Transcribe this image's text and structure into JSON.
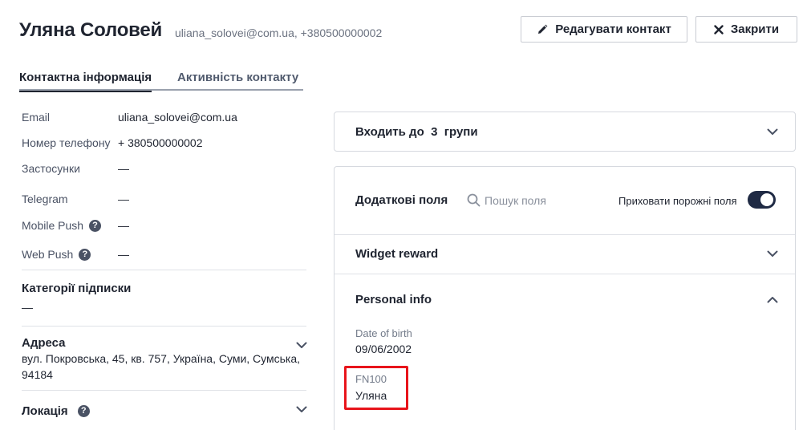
{
  "header": {
    "name": "Уляна Соловей",
    "subtitle": "uliana_solovei@com.ua, +380500000002",
    "edit_label": "Редагувати контакт",
    "close_label": "Закрити"
  },
  "tabs": [
    {
      "label": "Контактна інформація",
      "active": true
    },
    {
      "label": "Активність контакту",
      "active": false
    }
  ],
  "contact": {
    "rows": [
      {
        "label": "Email",
        "value": "uliana_solovei@com.ua"
      },
      {
        "label": "Номер телефону",
        "value": "+ 380500000002"
      },
      {
        "label": "Застосунки",
        "value": "—"
      },
      {
        "label": "Telegram",
        "value": "—"
      },
      {
        "label": "Mobile Push",
        "value": "—"
      },
      {
        "label": "Web Push",
        "value": "—"
      }
    ],
    "subscriptions": {
      "title": "Категорії підписки",
      "value": "—"
    },
    "address": {
      "title": "Адреса",
      "value": "вул. Покровська, 45, кв. 757, Україна, Суми, Сумська, 94184"
    },
    "location": {
      "title": "Локація"
    }
  },
  "groups": {
    "label": "Входить до  3  групи"
  },
  "fields": {
    "title": "Додаткові поля",
    "search_placeholder": "Пошук поля",
    "hide_empty_label": "Приховати порожні поля",
    "hide_empty_on": true,
    "sections": [
      {
        "title": "Widget reward",
        "expanded": false
      },
      {
        "title": "Personal info",
        "expanded": true
      }
    ],
    "personal_info": [
      {
        "label": "Date of birth",
        "value": "09/06/2002"
      },
      {
        "label": "FN100",
        "value": "Уляна"
      }
    ]
  },
  "colors": {
    "accent": "#1f2a44",
    "highlight": "#e8141b"
  }
}
